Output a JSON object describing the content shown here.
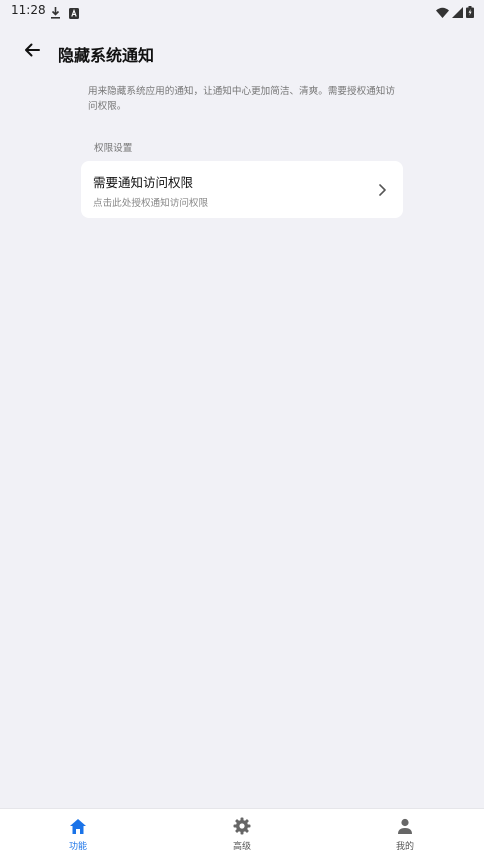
{
  "status_bar": {
    "time": "11:28",
    "left_icons": [
      "download-icon",
      "a-badge-icon"
    ],
    "right_icons": [
      "wifi-icon",
      "signal-icon",
      "battery-icon"
    ]
  },
  "header": {
    "title": "隐藏系统通知",
    "back_icon": "arrow-left-icon"
  },
  "main": {
    "description": "用来隐藏系统应用的通知，让通知中心更加简洁、清爽。需要授权通知访问权限。",
    "section_label": "权限设置",
    "permission_card": {
      "title": "需要通知访问权限",
      "subtitle": "点击此处授权通知访问权限",
      "chevron_icon": "chevron-right-icon"
    }
  },
  "bottom_nav": {
    "items": [
      {
        "label": "功能",
        "icon": "home-icon",
        "active": true
      },
      {
        "label": "高级",
        "icon": "gear-icon",
        "active": false
      },
      {
        "label": "我的",
        "icon": "person-icon",
        "active": false
      }
    ]
  },
  "colors": {
    "background": "#f1f1f6",
    "card": "#ffffff",
    "accent": "#1a73e8",
    "inactive": "#555555"
  }
}
